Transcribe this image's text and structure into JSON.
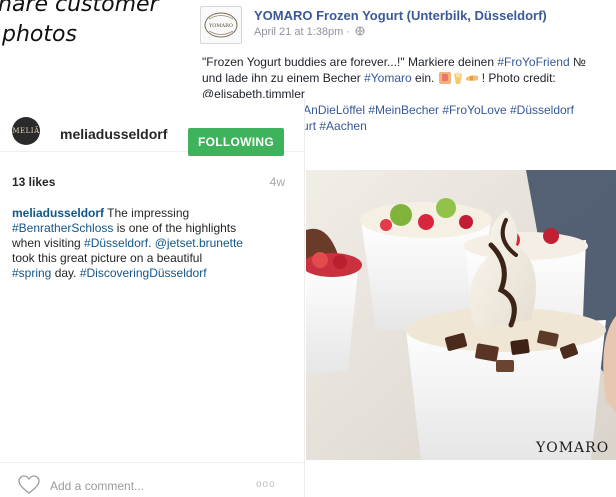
{
  "caption_fragment": {
    "line1": "hare customer",
    "line2": "photos"
  },
  "facebook_post": {
    "page_name": "YOMARO Frozen Yogurt (Unterbilk, Düsseldorf)",
    "timestamp": "April 21 at 1:38pm · ",
    "text_lines": [
      {
        "pre": "\"Frozen Yogurt buddies are forever...!\" Markiere deinen ",
        "link": "#FroYoFriend",
        "post": " №"
      },
      {
        "pre": "und lade ihn zu einem Becher ",
        "link": "#Yomaro",
        "post": " ein. ",
        "emoji": true,
        "post2": "! Photo credit:"
      },
      {
        "pre": "@elisabeth.timmler",
        "link": "",
        "post": ""
      },
      {
        "pre": "",
        "link": "#FroYoWand #RanAnDieLöffel #MeinBecher #FroYoLove #Düsseldorf",
        "post": ""
      },
      {
        "pre": "",
        "link": "#Hamburg #Frankfurt #Aachen",
        "post": ""
      }
    ],
    "photo_brand_text": "YOMARO"
  },
  "instagram_post": {
    "username": "meliadusseldorf",
    "avatar_logo": "MELIÃ",
    "follow_label": "FOLLOWING",
    "likes": "13 likes",
    "age": "4w",
    "caption_lines": [
      {
        "user": "meliadusseldorf",
        "text": " The impressing"
      },
      {
        "tag": "#BenratherSchloss",
        "text": " is one of the highlights"
      },
      {
        "text": "when visiting ",
        "tag": "#Düsseldorf",
        "text2": ". ",
        "tag2": "@jetset.brunette"
      },
      {
        "text": "took this great picture on a beautiful"
      },
      {
        "tag": "#spring",
        "text": " day. ",
        "tag2": "#DiscoveringDüsseldorf"
      }
    ],
    "comment_placeholder": "Add a comment...",
    "more_label": "ooo"
  },
  "colors": {
    "follow_green": "#3fb35c",
    "ig_link": "#125688",
    "fb_link": "#365899",
    "fb_name": "#3b5998"
  }
}
